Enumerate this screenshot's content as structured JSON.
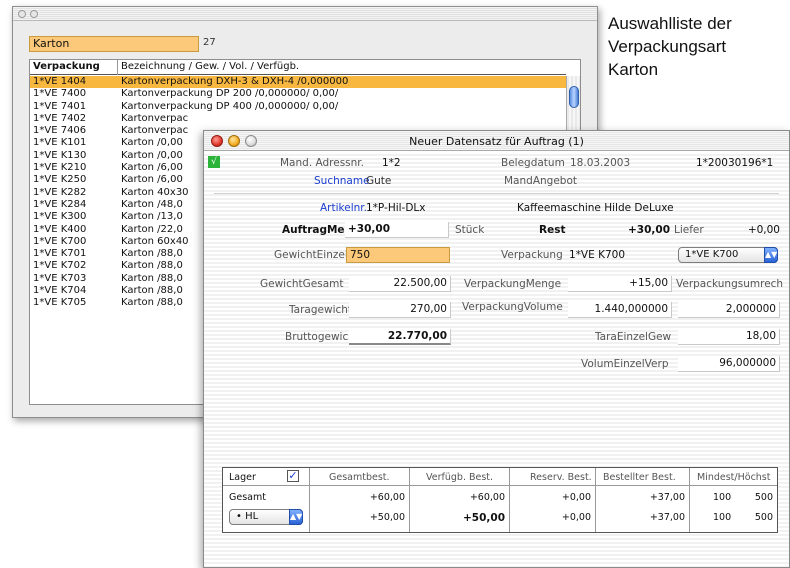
{
  "caption": [
    "Auswahlliste der",
    "Verpackungsart",
    "Karton"
  ],
  "back_window": {
    "search_value": "Karton",
    "count": "27",
    "columns": [
      "Verpackung",
      "Bezeichnung / Gew. / Vol. / Verfügb."
    ],
    "rows": [
      [
        "1*VE 1404",
        "Kartonverpackung DXH-3 & DXH-4 /0,000000"
      ],
      [
        "1*VE 7400",
        "Kartonverpackung DP 200 /0,000000/ 0,00/"
      ],
      [
        "1*VE 7401",
        "Kartonverpackung DP 400 /0,000000/ 0,00/"
      ],
      [
        "1*VE 7402",
        "Kartonverpac"
      ],
      [
        "1*VE 7406",
        "Kartonverpac"
      ],
      [
        "1*VE K101",
        "Karton /0,00"
      ],
      [
        "1*VE K130",
        "Karton /0,00"
      ],
      [
        "1*VE K210",
        "Karton /6,00"
      ],
      [
        "1*VE K250",
        "Karton /6,00"
      ],
      [
        "1*VE K282",
        "Karton 40x30"
      ],
      [
        "1*VE K284",
        "Karton /48,0"
      ],
      [
        "1*VE K300",
        "Karton /13,0"
      ],
      [
        "1*VE K400",
        "Karton /22,0"
      ],
      [
        "1*VE K700",
        "Karton 60x40"
      ],
      [
        "1*VE K701",
        "Karton /88,0"
      ],
      [
        "1*VE K702",
        "Karton /88,0"
      ],
      [
        "1*VE K703",
        "Karton /88,0"
      ],
      [
        "1*VE K704",
        "Karton /88,0"
      ],
      [
        "1*VE K705",
        "Karton /88,0"
      ]
    ],
    "selected_index": 0
  },
  "front_window": {
    "title": "Neuer Datensatz für  Auftrag (1)",
    "check_mark": "√",
    "mand_adressnr_label": "Mand. Adressnr.",
    "mand_adressnr_value": "1*2",
    "belegdatum_label": "Belegdatum",
    "belegdatum_value": "18.03.2003",
    "belegnr_value": "1*20030196*1",
    "suchname_label": "Suchname",
    "suchname_value": "Gute",
    "mandangebot_label": "MandAngebot",
    "artikelnr_label": "Artikelnr.",
    "artikelnr_value": "1*P-Hil-DLx",
    "artikel_bezeichnung": "Kaffeemaschine Hilde DeLuxe",
    "auftragmenge_label": "AuftragMenge",
    "auftragmenge_value": "+30,00",
    "stueck_label": "Stück",
    "rest_label": "Rest",
    "rest_value": "+30,00",
    "liefer_label": "Liefer",
    "liefer_value": "+0,00",
    "gewichteinzel_label": "GewichtEinzel",
    "gewichteinzel_value": "750",
    "verpackung_label": "Verpackung",
    "verpackung_value": "1*VE K700",
    "verpackung_popup": "1*VE K700",
    "gewichtgesamt_label": "GewichtGesamt",
    "gewichtgesamt_value": "22.500,00",
    "verpackungmenge_label": "VerpackungMenge",
    "verpackungmenge_value": "+15,00",
    "verpackungsumrech_label": "Verpackungsumrech",
    "taragewicht_label": "Taragewicht",
    "taragewicht_value": "270,00",
    "verpackungvolume_label": "VerpackungVolume",
    "verpackungvolume_value": "1.440,000000",
    "verpackungvolume_value2": "2,000000",
    "bruttogewicht_label": "Bruttogewicht",
    "bruttogewicht_value": "22.770,00",
    "taraeinzelgew_label": "TaraEinzelGew",
    "taraeinzelgew_value": "18,00",
    "volumeinzelverp_label": "VolumEinzelVerp",
    "volumeinzelverp_value": "96,000000",
    "table": {
      "lager_label": "Lager",
      "lager_check": "✓",
      "headers": [
        "Gesamtbest.",
        "Verfügb. Best.",
        "Reserv. Best.",
        "Bestellter Best.",
        "Mindest/Höchst"
      ],
      "row1_label": "Gesamt",
      "row1": [
        "+60,00",
        "+60,00",
        "+0,00",
        "+37,00",
        "100",
        "500"
      ],
      "row2_popup": "• HL",
      "row2": [
        "+50,00",
        "+50,00",
        "+0,00",
        "+37,00",
        "100",
        "500"
      ]
    },
    "back_link": "<--"
  }
}
